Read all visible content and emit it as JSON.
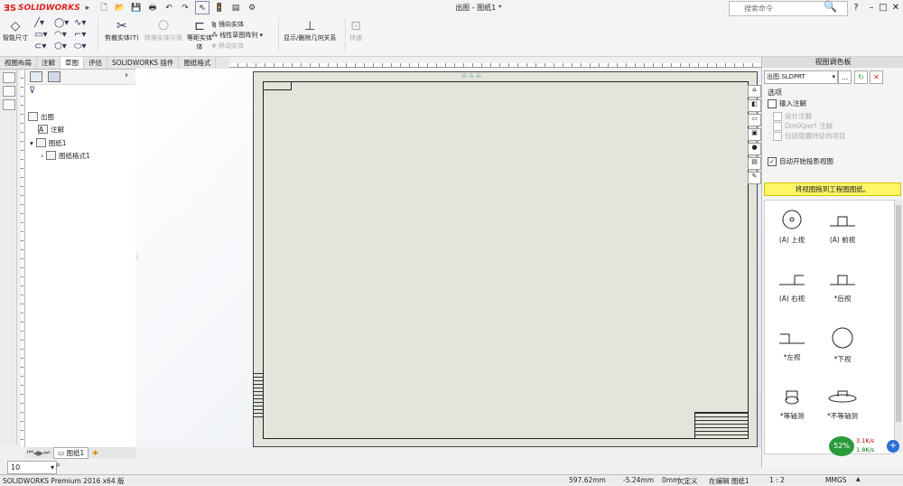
{
  "titlebar": {
    "app_logo": "SOLIDWORKS",
    "doc_title": "出图 - 图纸1 *",
    "search_placeholder": "搜索命令",
    "help": "?",
    "minimize": "–",
    "restore": "□",
    "close": "✕"
  },
  "commands": {
    "smart_dim": "智能尺寸",
    "trim": "剪裁实体(T)",
    "convert": "转换实体引用",
    "offset": "等距实体",
    "offset2": "体",
    "mirror": "镜向实体",
    "linear_pattern": "线性草图阵列",
    "move": "移动实体",
    "relations": "显示/删除几何关系",
    "quick": "快速"
  },
  "tabs": [
    {
      "label": "视图布局"
    },
    {
      "label": "注解"
    },
    {
      "label": "草图"
    },
    {
      "label": "评估"
    },
    {
      "label": "SOLIDWORKS 插件"
    },
    {
      "label": "图纸格式"
    }
  ],
  "tree": {
    "root": "出图",
    "annotations": "注解",
    "sheet": "图纸1",
    "format": "图纸格式1"
  },
  "palette": {
    "title": "视图调色板",
    "source": "出图.SLDPRT",
    "ellipsis": "...",
    "options_label": "选项",
    "import_annotations": "输入注解",
    "design_annotations": "设计注解",
    "dimxpert": "DimXpert 注解",
    "hidden_features": "包括隐藏特征的项目",
    "auto_projection": "自动开始投影视图",
    "drag_hint": "将视图拖到工程图图纸。",
    "views": [
      {
        "label": "(A) 上视",
        "icon": "circle-dot"
      },
      {
        "label": "(A) 前视",
        "icon": "profile"
      },
      {
        "label": "(A) 右视",
        "icon": "profile-right"
      },
      {
        "label": "*后视",
        "icon": "profile"
      },
      {
        "label": "*左视",
        "icon": "profile-left"
      },
      {
        "label": "*下视",
        "icon": "circle"
      },
      {
        "label": "*等轴测",
        "icon": "iso"
      },
      {
        "label": "*不等轴测",
        "icon": "iso2"
      }
    ]
  },
  "sheet_tab": "图纸1",
  "zoom_value": "10",
  "status": {
    "product": "SOLIDWORKS Premium 2016 x64 版",
    "x": "597.62mm",
    "y": "-5.24mm",
    "z": "0mm",
    "state": "欠定义",
    "editing": "在编辑 图纸1",
    "scale": "1 : 2",
    "units": "MMGS",
    "arrow": "▲"
  },
  "net": {
    "percent": "52%",
    "up": "3.1K/s",
    "down": "1.8K/s"
  },
  "colors": {
    "accent": "#d22",
    "hint_bg": "#fff666"
  }
}
